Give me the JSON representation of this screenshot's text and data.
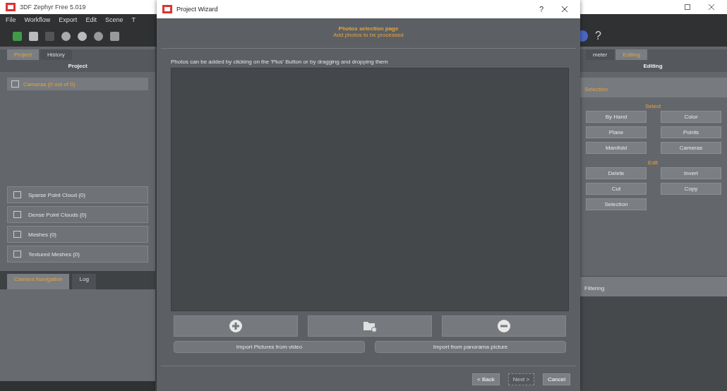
{
  "app": {
    "title": "3DF Zephyr Free 5.019",
    "menu": [
      "File",
      "Workflow",
      "Export",
      "Edit",
      "Scene",
      "T"
    ],
    "help": "?"
  },
  "left_panel": {
    "tabs": [
      {
        "label": "Project",
        "selected": true
      },
      {
        "label": "History",
        "selected": false
      }
    ],
    "header": "Project",
    "cameras": "Cameras (0 out of 0)",
    "sections": [
      "Sparse Point Cloud (0)",
      "Dense Point Clouds (0)",
      "Meshes (0)",
      "Textured Meshes (0)"
    ],
    "bottom_tabs": [
      {
        "label": "Camera Navigation",
        "selected": true
      },
      {
        "label": "Log",
        "selected": false
      }
    ]
  },
  "right_panel": {
    "tabs": [
      {
        "label": "meter",
        "selected": false
      },
      {
        "label": "Editing",
        "selected": true
      }
    ],
    "header": "Editing",
    "section": "Selection",
    "groups": [
      {
        "title": "Select",
        "buttons": [
          "By Hand",
          "Color",
          "Plane",
          "Points",
          "Manifold",
          "Cameras"
        ]
      },
      {
        "title": "Edit",
        "buttons": [
          "Delete",
          "Invert",
          "Cut",
          "Copy",
          "Selection"
        ]
      }
    ],
    "footer": "Filtering"
  },
  "dialog": {
    "title": "Project Wizard",
    "help": "?",
    "heading": "Photos selection page",
    "subheading": "Add photos to be processed",
    "instruction": "Photos can be added by clicking on the 'Plus' Button or by dragging and dropping them",
    "import_buttons": [
      "Import Pictures from video",
      "Import from panorama picture"
    ],
    "nav_buttons": [
      {
        "label": "< Back",
        "disabled": false
      },
      {
        "label": "Next >",
        "disabled": true
      },
      {
        "label": "Cancel",
        "disabled": false
      }
    ]
  }
}
